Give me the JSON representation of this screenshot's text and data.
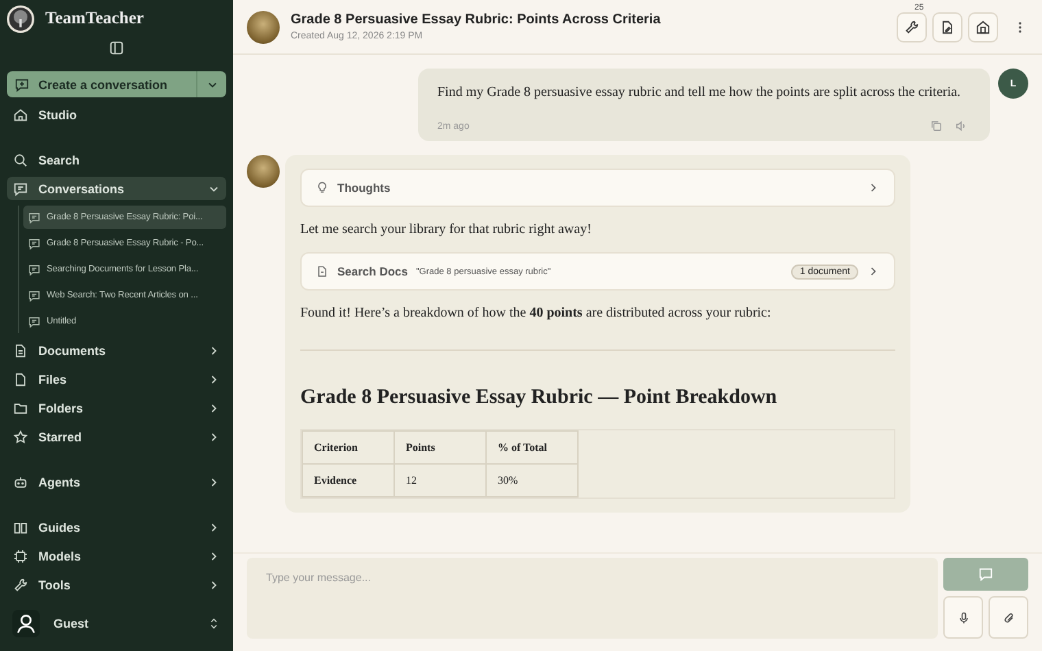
{
  "app": {
    "name": "TeamTeacher"
  },
  "sidebar": {
    "create_button": "Create a conversation",
    "nav_groups": [
      [
        {
          "label": "Studio",
          "kind": "link"
        }
      ],
      [
        {
          "label": "Search",
          "kind": "link"
        },
        {
          "label": "Conversations",
          "kind": "group",
          "expanded": true,
          "selected": true,
          "children": [
            {
              "label": "Grade 8 Persuasive Essay Rubric: Poi...",
              "selected": true
            },
            {
              "label": "Grade 8 Persuasive Essay Rubric - Po...",
              "selected": false
            },
            {
              "label": "Searching Documents for Lesson Pla...",
              "selected": false
            },
            {
              "label": "Web Search: Two Recent Articles on ...",
              "selected": false
            },
            {
              "label": "Untitled",
              "selected": false
            }
          ]
        },
        {
          "label": "Documents",
          "kind": "group",
          "expanded": false,
          "selected": false
        },
        {
          "label": "Files",
          "kind": "group",
          "expanded": false,
          "selected": false
        },
        {
          "label": "Folders",
          "kind": "group",
          "expanded": false,
          "selected": false
        },
        {
          "label": "Starred",
          "kind": "group",
          "expanded": false,
          "selected": false
        }
      ],
      [
        {
          "label": "Agents",
          "kind": "group",
          "expanded": false,
          "selected": false
        }
      ],
      [
        {
          "label": "Guides",
          "kind": "group",
          "expanded": false,
          "selected": false
        },
        {
          "label": "Models",
          "kind": "group",
          "expanded": false,
          "selected": false
        },
        {
          "label": "Tools",
          "kind": "group",
          "expanded": false,
          "selected": false
        }
      ]
    ],
    "user": {
      "name": "Guest"
    }
  },
  "header": {
    "title": "Grade 8 Persuasive Essay Rubric: Points Across Criteria",
    "created": "Created Aug 12, 2026 2:19 PM",
    "tools_badge": "25"
  },
  "messages": [
    {
      "kind": "user",
      "avatar": "L",
      "text": "Find my Grade 8 persuasive essay rubric and tell me how the points are split across the criteria.",
      "time": "2m ago"
    },
    {
      "kind": "assistant",
      "thoughts": "Thoughts",
      "intro": "Let me search your library for that rubric right away!",
      "tool": {
        "label": "Search Docs",
        "query": "\"Grade 8 persuasive essay rubric\"",
        "result": "1 document"
      },
      "summary": "Found it! Here’s a breakdown of how the **40 points** are distributed across your rubric:",
      "heading": "Grade 8 Persuasive Essay Rubric — Point Breakdown",
      "table": {
        "columns": [
          "Criterion",
          "Points",
          "% of Total"
        ],
        "rows": [
          [
            "Evidence",
            "12",
            "30%"
          ]
        ]
      }
    }
  ],
  "composer": {
    "placeholder": "Type your message..."
  }
}
